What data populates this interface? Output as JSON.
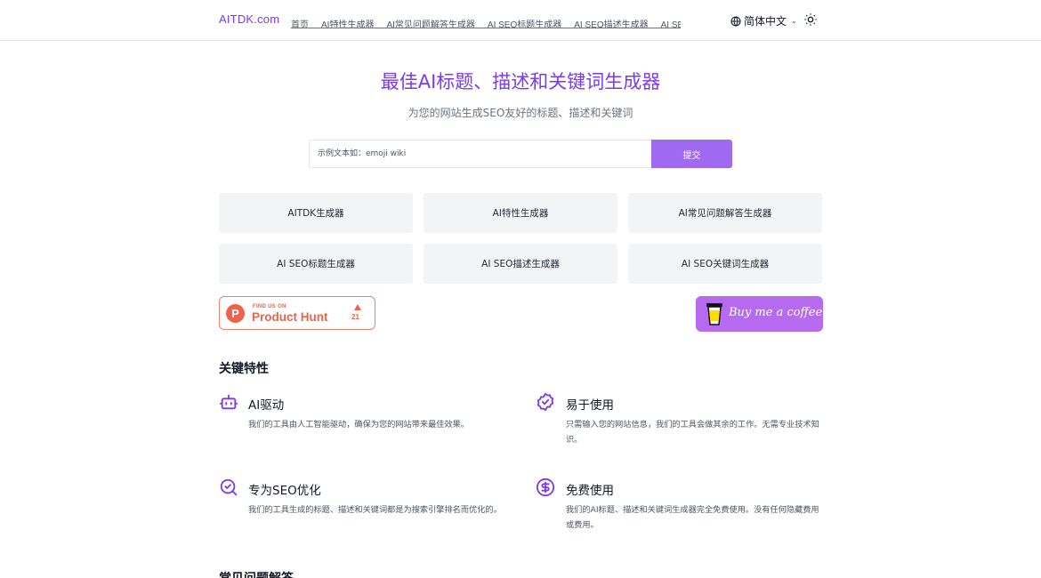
{
  "header": {
    "logo": "AITDK.com",
    "nav": [
      "首页",
      "AI特性生成器",
      "AI常见问题解答生成器",
      "AI SEO标题生成器",
      "AI SEO描述生成器",
      "AI SEO关键词生"
    ],
    "language": "简体中文"
  },
  "hero": {
    "title": "最佳AI标题、描述和关键词生成器",
    "subtitle": "为您的网站生成SEO友好的标题、描述和关键词",
    "search_placeholder": "示例文本如：emoji wiki",
    "submit_label": "提交"
  },
  "cards": [
    "AITDK生成器",
    "AI特性生成器",
    "AI常见问题解答生成器",
    "AI SEO标题生成器",
    "AI SEO描述生成器",
    "AI SEO关键词生成器"
  ],
  "badges": {
    "producthunt": {
      "small": "FIND US ON",
      "big": "Product Hunt",
      "count": "21",
      "color": "#e8654b"
    },
    "coffee": {
      "text": "Buy me a coffee",
      "color": "#b56af0"
    }
  },
  "features": {
    "title": "关键特性",
    "items": [
      {
        "icon": "robot-icon",
        "title": "AI驱动",
        "desc": "我们的工具由人工智能驱动，确保为您的网站带来最佳效果。"
      },
      {
        "icon": "badge-check-icon",
        "title": "易于使用",
        "desc": "只需输入您的网站信息，我们的工具会做其余的工作。无需专业技术知识。"
      },
      {
        "icon": "search-check-icon",
        "title": "专为SEO优化",
        "desc": "我们的工具生成的标题、描述和关键词都是为搜索引擎排名而优化的。"
      },
      {
        "icon": "dollar-icon",
        "title": "免费使用",
        "desc": "我们的AI标题、描述和关键词生成器完全免费使用。没有任何隐藏费用或费用。"
      }
    ]
  },
  "faq": {
    "title": "常见问题解答"
  },
  "colors": {
    "accent": "#7c3aed",
    "button": "#a06af0"
  }
}
